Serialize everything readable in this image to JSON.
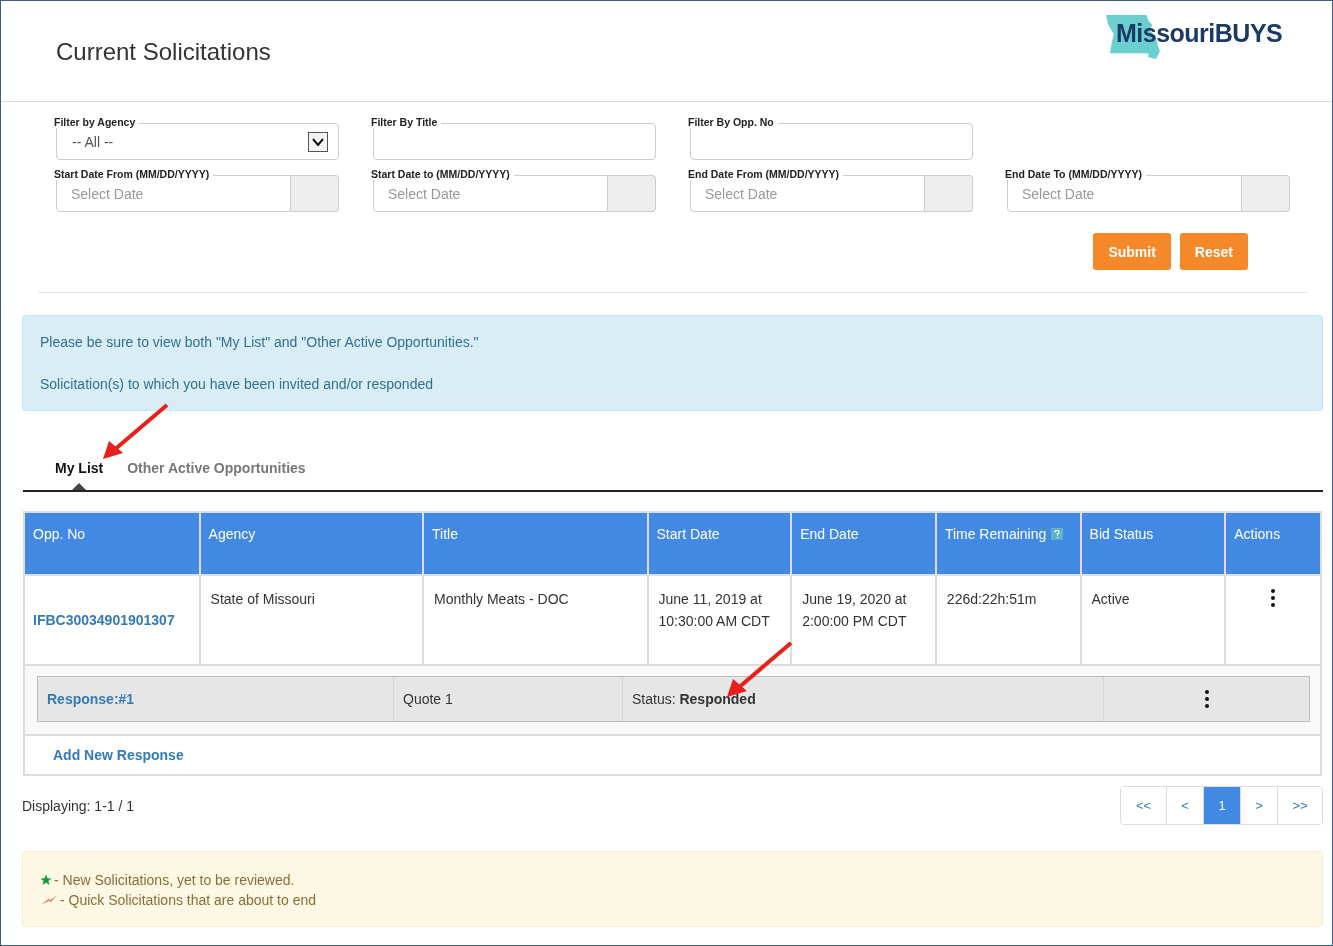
{
  "header": {
    "title": "Current Solicitations",
    "logo_text": "MissouriBUYS"
  },
  "filters": [
    {
      "kind": "select",
      "label": "Filter by Agency",
      "value": "-- All --"
    },
    {
      "kind": "text",
      "label": "Filter By Title"
    },
    {
      "kind": "text",
      "label": "Filter By Opp. No"
    },
    {
      "kind": "date",
      "label": "Start Date From (MM/DD/YYYY)",
      "placeholder": "Select Date"
    },
    {
      "kind": "date",
      "label": "Start Date to (MM/DD/YYYY)",
      "placeholder": "Select Date"
    },
    {
      "kind": "date",
      "label": "End Date From (MM/DD/YYYY)",
      "placeholder": "Select Date"
    },
    {
      "kind": "date",
      "label": "End Date To (MM/DD/YYYY)",
      "placeholder": "Select Date"
    }
  ],
  "buttons": [
    "Submit",
    "Reset"
  ],
  "notice": [
    "Please be sure to view both \"My List\" and \"Other Active Opportunities.\"",
    "Solicitation(s) to which you have been invited and/or responded"
  ],
  "tabs": [
    {
      "label": "My List",
      "selected": true
    },
    {
      "label": "Other Active Opportunities",
      "selected": false
    }
  ],
  "table": {
    "columns": [
      "Opp. No",
      "Agency",
      "Title",
      "Start Date",
      "End Date",
      "Time Remaining",
      "Bid Status",
      "Actions"
    ],
    "rows": [
      {
        "opp_no": "IFBC30034901901307",
        "agency": "State of Missouri",
        "title": "Monthly Meats - DOC",
        "start_date": "June 11, 2019 at 10:30:00 AM CDT",
        "end_date": "June 19, 2020 at 2:00:00 PM CDT",
        "time_remaining": "226d:22h:51m",
        "bid_status": "Active",
        "responses": [
          {
            "label": "Response:#1",
            "name": "Quote 1",
            "status": "Status: **Responded**"
          }
        ],
        "add_response": "Add New Response"
      }
    ]
  },
  "pagination": {
    "displaying": "Displaying: 1-1 / 1",
    "pages": [
      {
        "label": "<<",
        "selected": false
      },
      {
        "label": "<",
        "selected": false
      },
      {
        "label": "1",
        "selected": true
      },
      {
        "label": ">",
        "selected": false
      },
      {
        "label": ">>",
        "selected": false
      }
    ]
  },
  "legend": [
    {
      "kind": "star",
      "text": "- New Solicitations, yet to be reviewed."
    },
    {
      "kind": "flash",
      "text": " - Quick Solicitations that are about to end"
    }
  ]
}
